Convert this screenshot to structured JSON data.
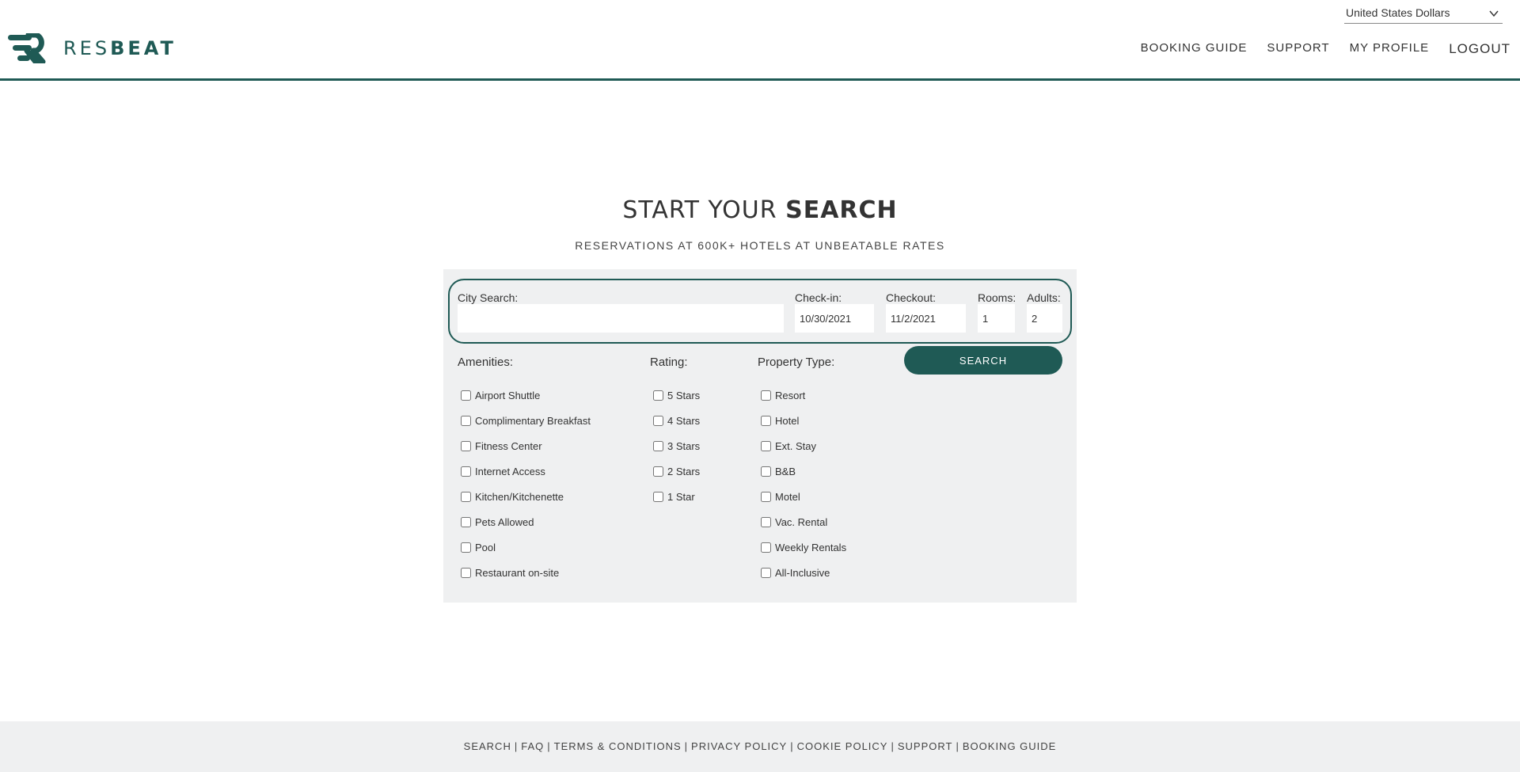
{
  "header": {
    "logo_prefix": "RES",
    "logo_suffix": "BEAT",
    "currency": "United States Dollars",
    "nav": [
      "BOOKING GUIDE",
      "SUPPORT",
      "MY PROFILE",
      "LOGOUT"
    ]
  },
  "main": {
    "heading_light": "START YOUR ",
    "heading_bold": "SEARCH",
    "subheading": "RESERVATIONS AT 600K+ HOTELS AT UNBEATABLE RATES"
  },
  "search": {
    "city_label": "City Search:",
    "city_value": "",
    "checkin_label": "Check-in:",
    "checkin_value": "10/30/2021",
    "checkout_label": "Checkout:",
    "checkout_value": "11/2/2021",
    "rooms_label": "Rooms:",
    "rooms_value": "1",
    "adults_label": "Adults:",
    "adults_value": "2",
    "button": "SEARCH"
  },
  "filters": {
    "amenities_label": "Amenities:",
    "amenities": [
      "Airport Shuttle",
      "Complimentary Breakfast",
      "Fitness Center",
      "Internet Access",
      "Kitchen/Kitchenette",
      "Pets Allowed",
      "Pool",
      "Restaurant on-site"
    ],
    "rating_label": "Rating:",
    "ratings": [
      "5 Stars",
      "4 Stars",
      "3 Stars",
      "2 Stars",
      "1 Star"
    ],
    "property_label": "Property Type:",
    "property_types": [
      "Resort",
      "Hotel",
      "Ext. Stay",
      "B&B",
      "Motel",
      "Vac. Rental",
      "Weekly Rentals",
      "All-Inclusive"
    ]
  },
  "footer": {
    "links": [
      "SEARCH",
      "FAQ",
      "TERMS & CONDITIONS",
      "PRIVACY POLICY",
      "COOKIE POLICY",
      "SUPPORT",
      "BOOKING GUIDE"
    ]
  },
  "colors": {
    "brand": "#1f5a55",
    "panel_bg": "#eff0f1"
  }
}
